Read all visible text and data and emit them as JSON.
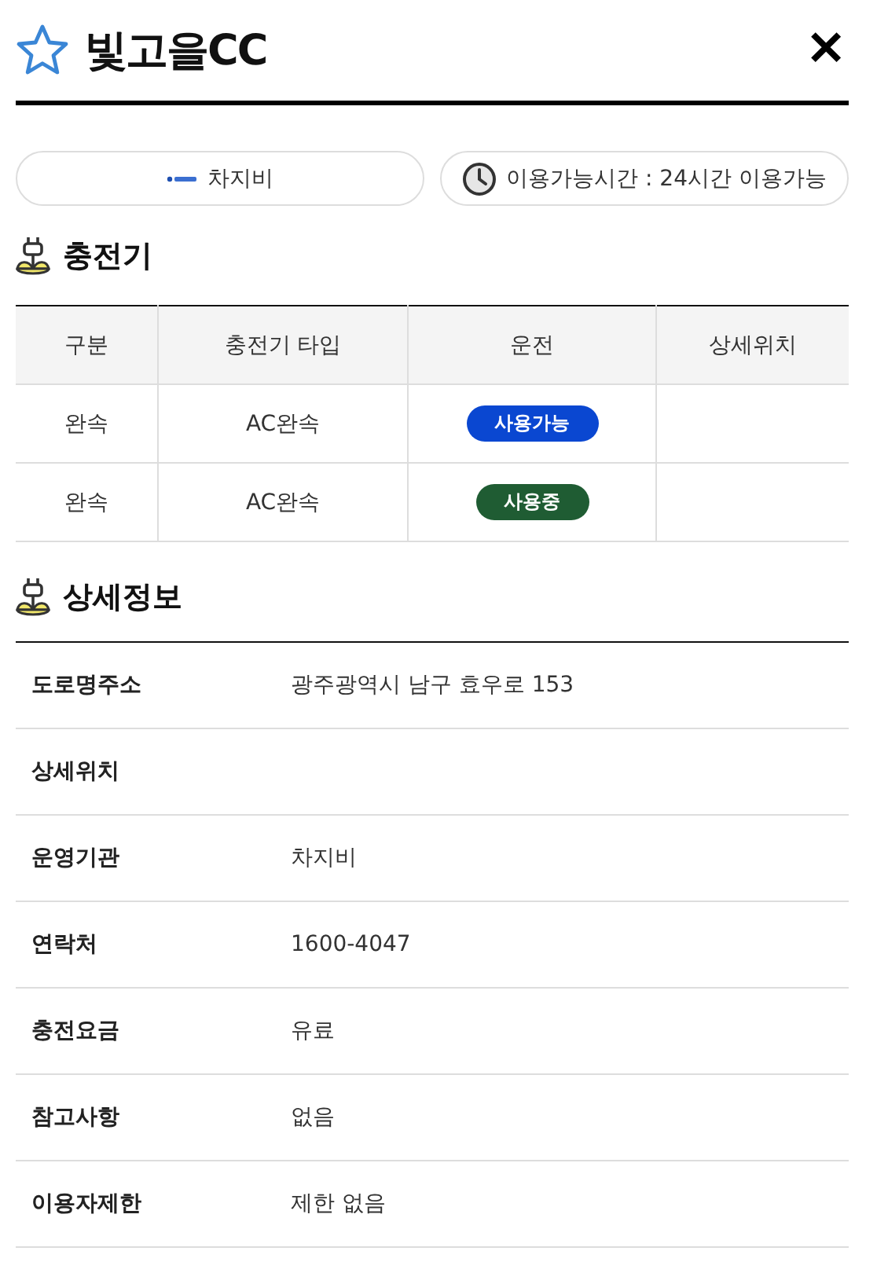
{
  "header": {
    "title": "빛고을CC",
    "close": "✕"
  },
  "info_pills": [
    {
      "kind": "operator",
      "text": "차지비"
    },
    {
      "kind": "hours",
      "text": "이용가능시간 : 24시간 이용가능"
    }
  ],
  "chargers": {
    "title": "충전기",
    "columns": [
      "구분",
      "충전기 타입",
      "운전",
      "상세위치"
    ],
    "rows": [
      {
        "category": "완속",
        "type": "AC완속",
        "status": {
          "label": "사용가능",
          "color": "#0a47d1"
        }
      },
      {
        "category": "완속",
        "type": "AC완속",
        "status": {
          "label": "사용중",
          "color": "#1f5c33"
        }
      }
    ]
  },
  "details": {
    "title": "상세정보",
    "rows": [
      {
        "label": "도로명주소",
        "value": "광주광역시 남구 효우로 153"
      },
      {
        "label": "상세위치"
      },
      {
        "label": "운영기관",
        "value": "차지비"
      },
      {
        "label": "연락처",
        "value": "1600-4047"
      },
      {
        "label": "충전요금",
        "value": "유료"
      },
      {
        "label": "참고사항",
        "value": "없음"
      },
      {
        "label": "이용자제한",
        "value": "제한 없음"
      }
    ]
  }
}
